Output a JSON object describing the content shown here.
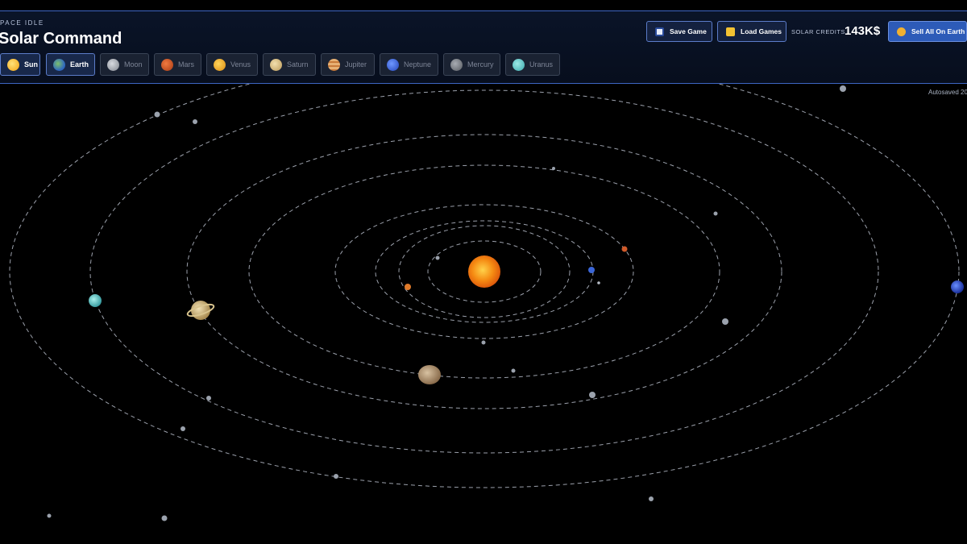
{
  "header": {
    "kicker": "PACE IDLE",
    "title": "Solar Command"
  },
  "tabs": [
    {
      "label": "Sun",
      "icon": "sun-icon",
      "color": "#f2b319",
      "active": true
    },
    {
      "label": "Earth",
      "icon": "earth-icon",
      "color": "#3d7fcf",
      "active": true
    },
    {
      "label": "Moon",
      "icon": "moon-icon",
      "color": "#9aa0a8",
      "active": false
    },
    {
      "label": "Mars",
      "icon": "mars-icon",
      "color": "#c8491e",
      "active": false
    },
    {
      "label": "Venus",
      "icon": "venus-icon",
      "color": "#e8a020",
      "active": false
    },
    {
      "label": "Saturn",
      "icon": "saturn-icon",
      "color": "#d9c08a",
      "active": false
    },
    {
      "label": "Jupiter",
      "icon": "jupiter-icon",
      "color": "#d69050",
      "active": false
    },
    {
      "label": "Neptune",
      "icon": "neptune-icon",
      "color": "#3a63d8",
      "active": false
    },
    {
      "label": "Mercury",
      "icon": "mercury-icon",
      "color": "#7c8088",
      "active": false
    },
    {
      "label": "Uranus",
      "icon": "uranus-icon",
      "color": "#5ec5c8",
      "active": false
    }
  ],
  "actions": {
    "save_label": "Save Game",
    "load_label": "Load Games",
    "sell_label": "Sell All On Earth"
  },
  "credits": {
    "label": "SOLAR CREDITS",
    "value": "143K$"
  },
  "autosave": "Autosaved 20",
  "colors": {
    "accent": "#3d66c4",
    "header_bg": "#0a1428",
    "sun": "#f27a12"
  }
}
